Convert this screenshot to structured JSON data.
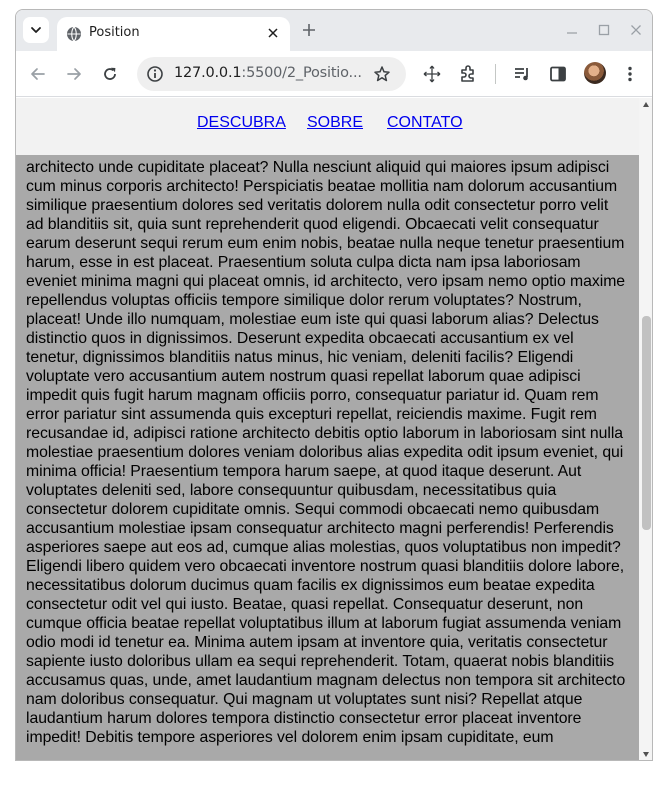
{
  "browser": {
    "tab": {
      "title": "Position",
      "favicon": "globe-icon"
    },
    "address": {
      "host": "127.0.0.1",
      "rest": ":5500/2_Positio..."
    },
    "icons": [
      "back-arrow-icon",
      "forward-arrow-icon",
      "reload-icon",
      "site-info-icon",
      "bookmark-star-icon",
      "move-icon",
      "extensions-icon",
      "media-controls-icon",
      "side-panel-icon",
      "profile-avatar",
      "kebab-menu-icon"
    ],
    "accent": "#e8eaed"
  },
  "page": {
    "nav": [
      {
        "label": "DESCUBRA"
      },
      {
        "label": "SOBRE"
      },
      {
        "label": "CONTATO"
      }
    ],
    "content_bg": "#a9a9a9",
    "nav_bg": "#f2f2f2",
    "link_color": "#0000ee",
    "text": "architecto unde cupiditate placeat? Nulla nesciunt aliquid qui maiores ipsum adipisci cum minus corporis architecto! Perspiciatis beatae mollitia nam dolorum accusantium similique praesentium dolores sed veritatis dolorem nulla odit consectetur porro velit ad blanditiis sit, quia sunt reprehenderit quod eligendi. Obcaecati velit consequatur earum deserunt sequi rerum eum enim nobis, beatae nulla neque tenetur praesentium harum, esse in est placeat. Praesentium soluta culpa dicta nam ipsa laboriosam eveniet minima magni qui placeat omnis, id architecto, vero ipsam nemo optio maxime repellendus voluptas officiis tempore similique dolor rerum voluptates? Nostrum, placeat! Unde illo numquam, molestiae eum iste qui quasi laborum alias? Delectus distinctio quos in dignissimos. Deserunt expedita obcaecati accusantium ex vel tenetur, dignissimos blanditiis natus minus, hic veniam, deleniti facilis? Eligendi voluptate vero accusantium autem nostrum quasi repellat laborum quae adipisci impedit quis fugit harum magnam officiis porro, consequatur pariatur id. Quam rem error pariatur sint assumenda quis excepturi repellat, reiciendis maxime. Fugit rem recusandae id, adipisci ratione architecto debitis optio laborum in laboriosam sint nulla molestiae praesentium dolores veniam doloribus alias expedita odit ipsum eveniet, qui minima officia! Praesentium tempora harum saepe, at quod itaque deserunt. Aut voluptates deleniti sed, labore consequuntur quibusdam, necessitatibus quia consectetur dolorem cupiditate omnis. Sequi commodi obcaecati nemo quibusdam accusantium molestiae ipsam consequatur architecto magni perferendis! Perferendis asperiores saepe aut eos ad, cumque alias molestias, quos voluptatibus non impedit? Eligendi libero quidem vero obcaecati inventore nostrum quasi blanditiis dolore labore, necessitatibus dolorum ducimus quam facilis ex dignissimos eum beatae expedita consectetur odit vel qui iusto. Beatae, quasi repellat. Consequatur deserunt, non cumque officia beatae repellat voluptatibus illum at laborum fugiat assumenda veniam odio modi id tenetur ea. Minima autem ipsam at inventore quia, veritatis consectetur sapiente iusto doloribus ullam ea sequi reprehenderit. Totam, quaerat nobis blanditiis accusamus quas, unde, amet laudantium magnam delectus non tempora sit architecto nam doloribus consequatur. Qui magnam ut voluptates sunt nisi? Repellat atque laudantium harum dolores tempora distinctio consectetur error placeat inventore impedit! Debitis tempore asperiores vel dolorem enim ipsam cupiditate, eum"
  }
}
